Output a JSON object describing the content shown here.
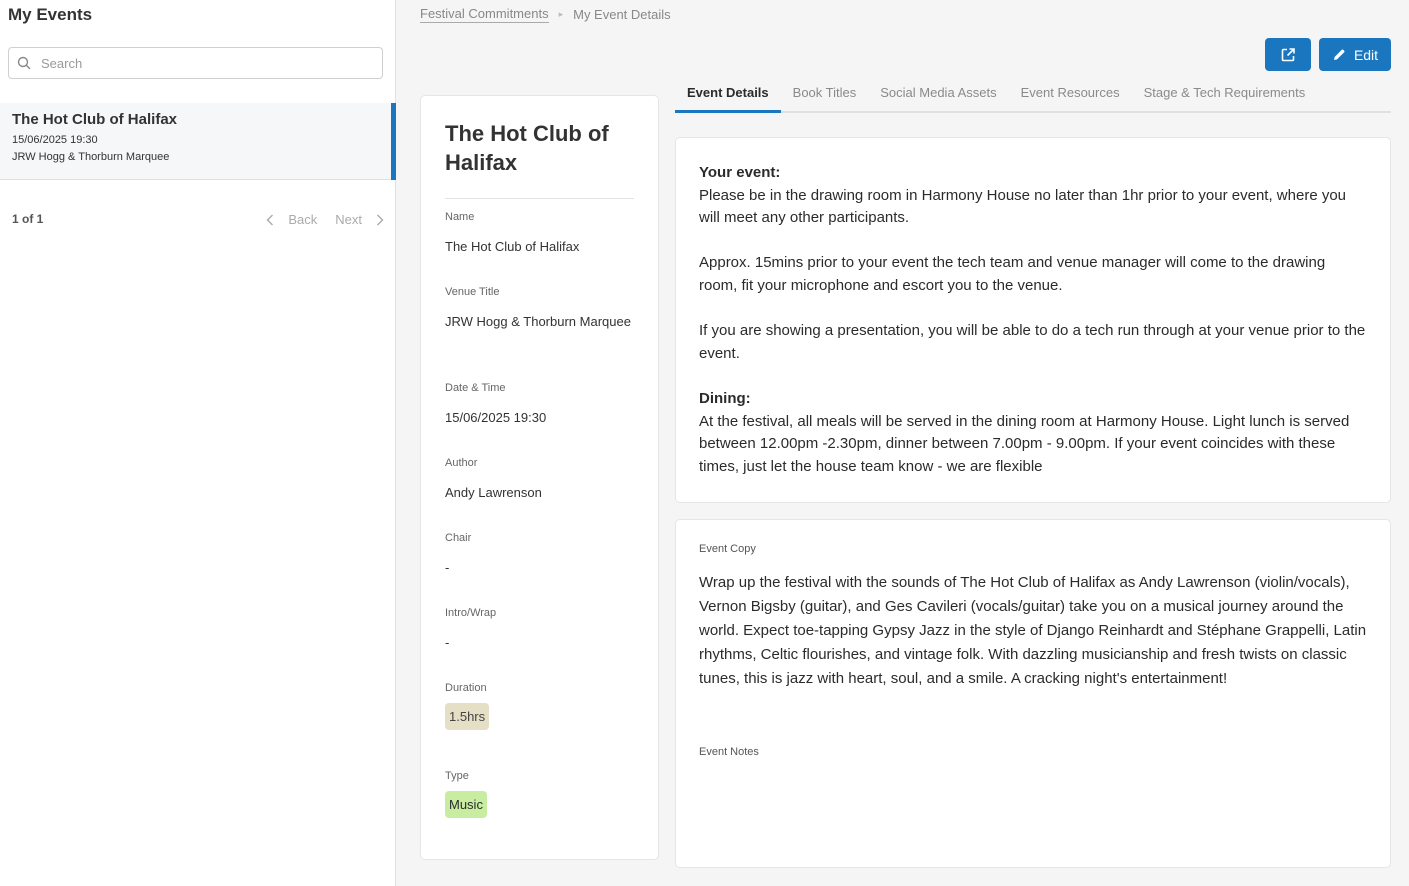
{
  "sidebar": {
    "title": "My Events",
    "search_placeholder": "Search",
    "events": [
      {
        "title": "The Hot Club of Halifax",
        "datetime": "15/06/2025 19:30",
        "venue": "JRW Hogg & Thorburn Marquee"
      }
    ],
    "pager": {
      "count": "1 of 1",
      "back": "Back",
      "next": "Next"
    }
  },
  "breadcrumb": {
    "parent": "Festival Commitments",
    "current": "My Event Details"
  },
  "actions": {
    "edit_label": "Edit"
  },
  "tabs": [
    "Event Details",
    "Book Titles",
    "Social Media Assets",
    "Event Resources",
    "Stage & Tech Requirements"
  ],
  "details": {
    "title": "The Hot Club of Halifax",
    "name_label": "Name",
    "name": "The Hot Club of Halifax",
    "venue_label": "Venue Title",
    "venue": "JRW Hogg & Thorburn Marquee",
    "datetime_label": "Date & Time",
    "datetime": "15/06/2025 19:30",
    "author_label": "Author",
    "author": "Andy Lawrenson",
    "chair_label": "Chair",
    "chair": "-",
    "intro_label": "Intro/Wrap",
    "intro": "-",
    "duration_label": "Duration",
    "duration": "1.5hrs",
    "type_label": "Type",
    "type": "Music"
  },
  "info": {
    "event_heading": "Your event:",
    "event_p1": "Please be in the drawing room in Harmony House no later than 1hr prior to your event, where you will meet any other participants.",
    "event_p2": "Approx. 15mins prior to your event the tech team and venue manager will come to the drawing room, fit your microphone and escort you to the venue.",
    "event_p3": "If you are showing a presentation, you will be able to do a tech run through at your venue prior to the event.",
    "dining_heading": "Dining:",
    "dining_p": "At the festival, all meals will be served in the dining room at Harmony House. Light lunch is served between 12.00pm -2.30pm, dinner between 7.00pm - 9.00pm. If your event coincides with these times, just let the house team know - we are flexible"
  },
  "copy": {
    "label": "Event Copy",
    "text": "Wrap up the festival with the sounds of The Hot Club of Halifax as Andy Lawrenson (violin/vocals), Vernon Bigsby (guitar), and Ges Cavileri (vocals/guitar) take you on a musical journey around the world. Expect toe-tapping Gypsy Jazz in the style of Django Reinhardt and Stéphane Grappelli, Latin rhythms, Celtic flourishes, and vintage folk. With dazzling musicianship and fresh twists on classic tunes, this is jazz with heart, soul, and a smile. A cracking night's entertainment!",
    "notes_label": "Event Notes"
  },
  "colors": {
    "accent": "#1976bf",
    "duration_badge": "#e5dfc6",
    "type_badge": "#c8eda0"
  }
}
